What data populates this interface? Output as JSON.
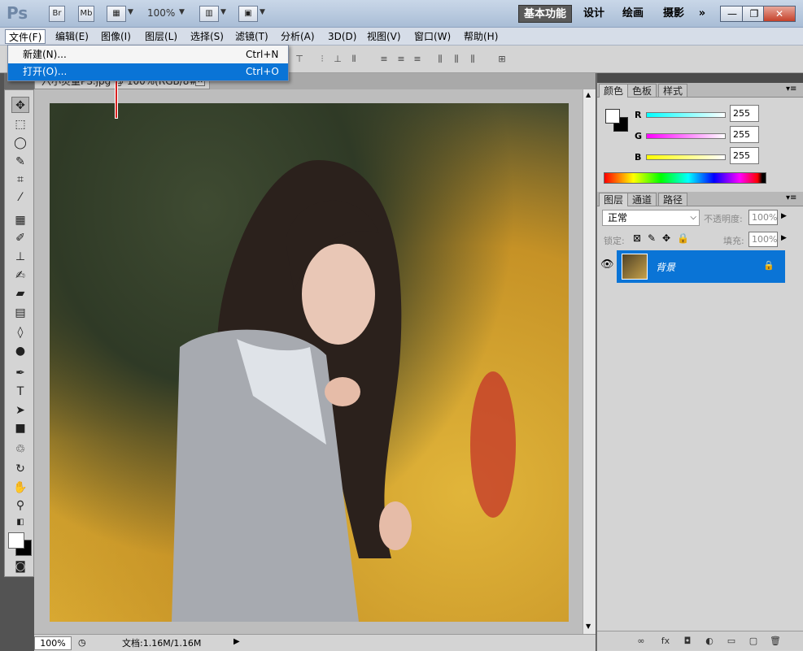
{
  "app": {
    "logo": "Ps",
    "title_buttons": [
      "Br",
      "Mb"
    ],
    "zoom": "100%",
    "workspaces": [
      "基本功能",
      "设计",
      "绘画",
      "摄影"
    ],
    "more": "»",
    "window_controls": [
      "—",
      "❐",
      "✕"
    ]
  },
  "menu": {
    "items": [
      "文件(F)",
      "编辑(E)",
      "图像(I)",
      "图层(L)",
      "选择(S)",
      "滤镜(T)",
      "分析(A)",
      "3D(D)",
      "视图(V)",
      "窗口(W)",
      "帮助(H)"
    ]
  },
  "file_menu": {
    "items": [
      {
        "label": "新建(N)...",
        "shortcut": "Ctrl+N"
      },
      {
        "label": "打开(O)...",
        "shortcut": "Ctrl+O"
      }
    ]
  },
  "document": {
    "tab_title": "六小灵童PS.jpg @ 100%(RGB/8#)",
    "close": "✕",
    "zoom": "100%",
    "info": "文档:1.16M/1.16M"
  },
  "color_panel": {
    "tabs": [
      "颜色",
      "色板",
      "样式"
    ],
    "channels": [
      {
        "name": "R",
        "value": "255",
        "color": "#00e5e5"
      },
      {
        "name": "G",
        "value": "255",
        "color": "#e500e5"
      },
      {
        "name": "B",
        "value": "255",
        "color": "#e5e500"
      }
    ]
  },
  "layers_panel": {
    "tabs": [
      "图层",
      "通道",
      "路径"
    ],
    "blend_mode": "正常",
    "opacity_label": "不透明度:",
    "opacity": "100%",
    "lock_label": "锁定:",
    "fill_label": "填充:",
    "fill": "100%",
    "layer_name": "背景"
  },
  "bottom_icons": [
    "∞",
    "fx",
    "◘",
    "◐",
    "▭",
    "▢",
    "🗑"
  ]
}
